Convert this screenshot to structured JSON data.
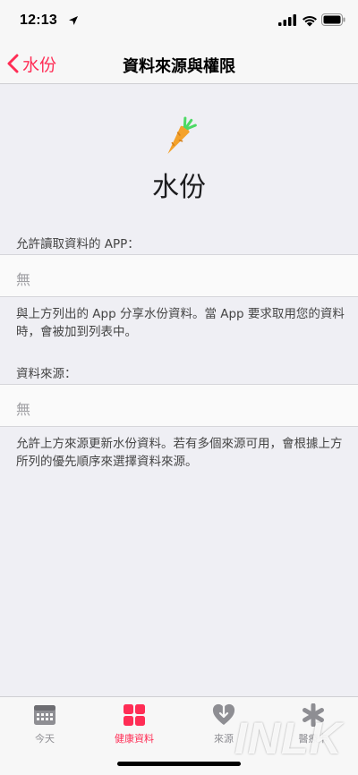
{
  "status_bar": {
    "time": "12:13",
    "icons": [
      "location-arrow-icon",
      "cellular-signal-icon",
      "wifi-icon",
      "battery-icon"
    ]
  },
  "nav": {
    "back_label": "水份",
    "title": "資料來源與權限"
  },
  "hero": {
    "icon": "carrot-icon",
    "title": "水份"
  },
  "read_section": {
    "header": "允許讀取資料的 APP：",
    "value": "無",
    "footer": "與上方列出的 App 分享水份資料。當 App 要求取用您的資料時，會被加到列表中。"
  },
  "source_section": {
    "header": "資料來源：",
    "value": "無",
    "footer": "允許上方來源更新水份資料。若有多個來源可用，會根據上方所列的優先順序來選擇資料來源。"
  },
  "tab_bar": {
    "tabs": [
      {
        "label": "今天",
        "icon": "today-calendar-icon",
        "active": false
      },
      {
        "label": "健康資料",
        "icon": "health-data-grid-icon",
        "active": true
      },
      {
        "label": "來源",
        "icon": "sources-heart-icon",
        "active": false
      },
      {
        "label": "醫療卡",
        "icon": "medical-id-icon",
        "active": false
      }
    ]
  },
  "watermark": "INLK",
  "colors": {
    "accent": "#ff2d55",
    "background": "#efeff4",
    "secondary_text": "#8e8e93",
    "carrot_orange": "#f4a22b",
    "carrot_green": "#4cd964"
  }
}
